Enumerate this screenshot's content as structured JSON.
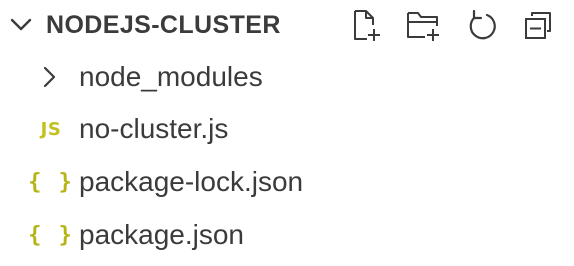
{
  "explorer": {
    "folder_title": "NODEJS-CLUSTER",
    "expanded": true,
    "actions": [
      {
        "name": "new-file-icon",
        "tooltip": ""
      },
      {
        "name": "new-folder-icon",
        "tooltip": ""
      },
      {
        "name": "refresh-icon",
        "tooltip": ""
      },
      {
        "name": "collapse-all-icon",
        "tooltip": ""
      }
    ],
    "items": [
      {
        "label": "node_modules",
        "type": "folder",
        "icon": "chevron-right-icon"
      },
      {
        "label": "no-cluster.js",
        "type": "file",
        "icon_text": "JS"
      },
      {
        "label": "package-lock.json",
        "type": "file",
        "icon_text": "{ }"
      },
      {
        "label": "package.json",
        "type": "file",
        "icon_text": "{ }"
      }
    ],
    "colors": {
      "text": "#3b3b3b",
      "js_icon": "#c2c11f",
      "json_icon": "#b5b518",
      "background": "#ffffff"
    }
  }
}
